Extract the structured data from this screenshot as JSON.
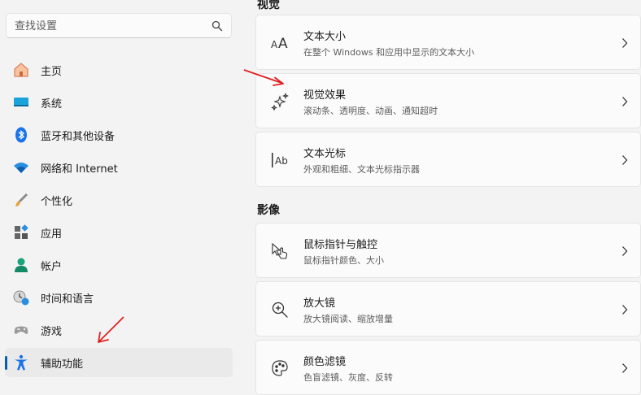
{
  "search": {
    "placeholder": "查找设置"
  },
  "sidebar": {
    "items": [
      {
        "label": "主页",
        "icon": "home-icon",
        "active": false
      },
      {
        "label": "系统",
        "icon": "system-icon",
        "active": false
      },
      {
        "label": "蓝牙和其他设备",
        "icon": "bluetooth-icon",
        "active": false
      },
      {
        "label": "网络和 Internet",
        "icon": "wifi-icon",
        "active": false
      },
      {
        "label": "个性化",
        "icon": "brush-icon",
        "active": false
      },
      {
        "label": "应用",
        "icon": "apps-icon",
        "active": false
      },
      {
        "label": "帐户",
        "icon": "account-icon",
        "active": false
      },
      {
        "label": "时间和语言",
        "icon": "clock-globe-icon",
        "active": false
      },
      {
        "label": "游戏",
        "icon": "gamepad-icon",
        "active": false
      },
      {
        "label": "辅助功能",
        "icon": "accessibility-icon",
        "active": true
      }
    ]
  },
  "main": {
    "vision_section_title": "视觉",
    "hearing_section_title": "影像",
    "cards": [
      {
        "title": "文本大小",
        "subtitle": "在整个 Windows 和应用中显示的文本大小",
        "icon": "text-size-icon"
      },
      {
        "title": "视觉效果",
        "subtitle": "滚动条、透明度、动画、通知超时",
        "icon": "sparkle-icon"
      },
      {
        "title": "文本光标",
        "subtitle": "外观和粗细、文本光标指示器",
        "icon": "text-cursor-icon"
      },
      {
        "title": "鼠标指针与触控",
        "subtitle": "鼠标指针颜色、大小",
        "icon": "pointer-touch-icon"
      },
      {
        "title": "放大镜",
        "subtitle": "放大镜阅读、缩放增量",
        "icon": "magnifier-icon"
      },
      {
        "title": "颜色滤镜",
        "subtitle": "色盲滤镜、灰度、反转",
        "icon": "palette-icon"
      }
    ]
  },
  "colors": {
    "accent": "#005fb8",
    "annotation_arrow": "#e02020"
  }
}
